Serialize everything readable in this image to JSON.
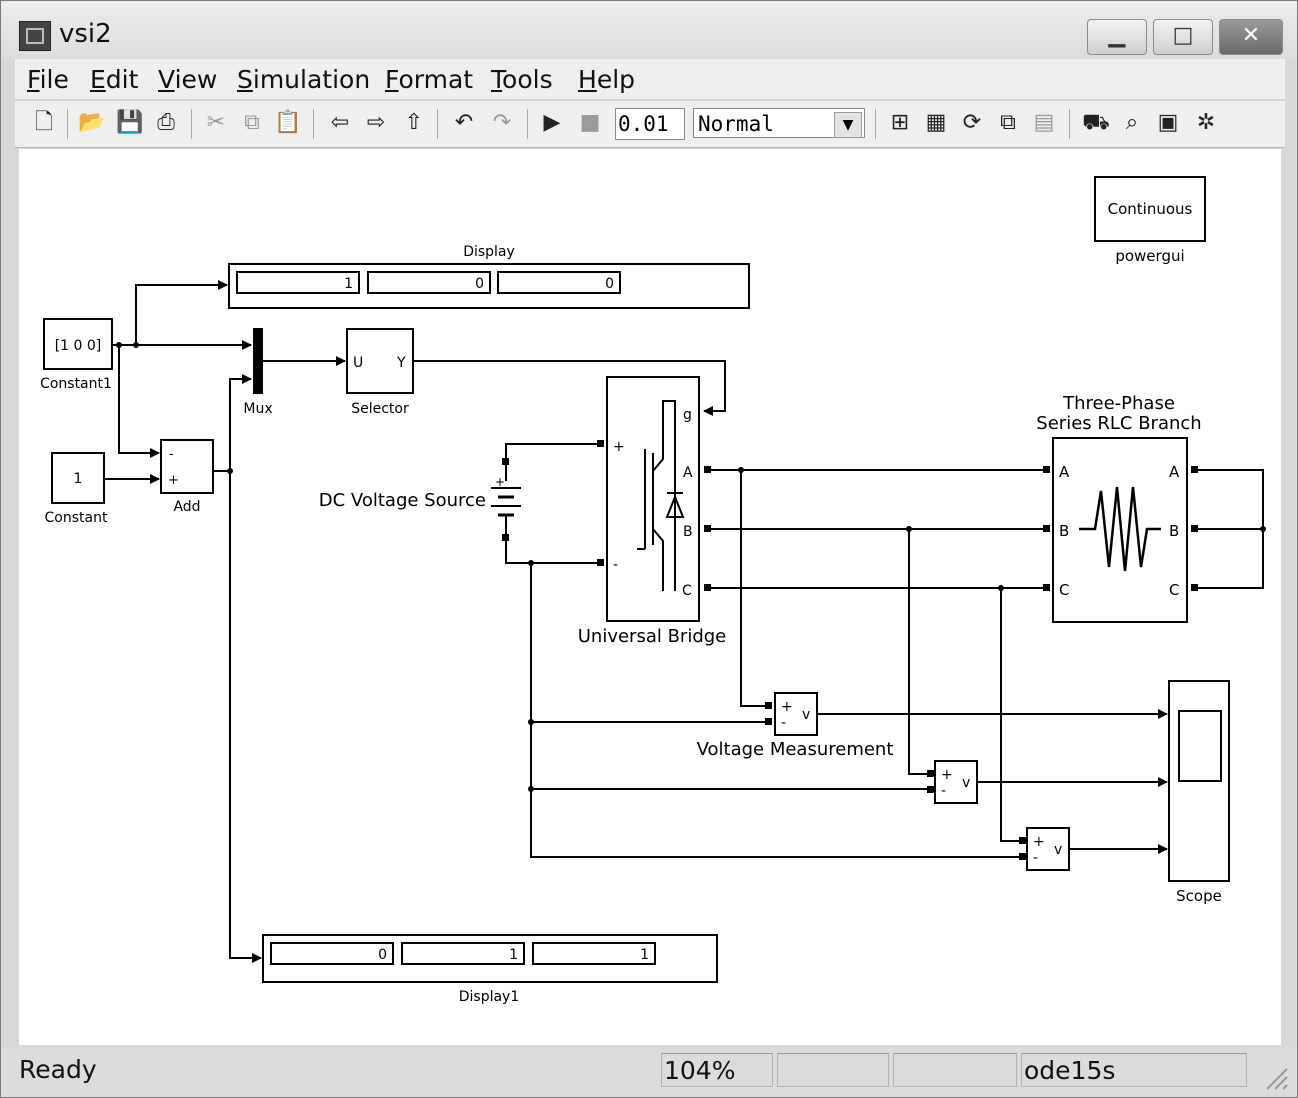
{
  "window": {
    "title": "vsi2",
    "minimize": "▁",
    "maximize": "□",
    "close": "✕"
  },
  "menu": [
    "File",
    "Edit",
    "View",
    "Simulation",
    "Format",
    "Tools",
    "Help"
  ],
  "toolbar": {
    "stop_time": "0.01",
    "sim_mode": "Normal",
    "icons": [
      "new-icon",
      "open-icon",
      "save-icon",
      "print-icon",
      "cut-icon",
      "copy-icon",
      "paste-icon",
      "back-icon",
      "forward-icon",
      "up-icon",
      "undo-icon",
      "redo-icon",
      "play-icon",
      "stop-icon",
      "library-icon",
      "debugger-icon",
      "refresh-icon",
      "build-icon",
      "model-icon",
      "explorer-icon",
      "advisor-icon",
      "browser-icon",
      "settings-icon"
    ]
  },
  "diagram": {
    "constant1": {
      "value": "[1 0 0]",
      "label": "Constant1"
    },
    "constant": {
      "value": "1",
      "label": "Constant"
    },
    "add": {
      "label": "Add",
      "in1": "-",
      "in2": "+"
    },
    "mux": {
      "label": "Mux"
    },
    "selector": {
      "label": "Selector",
      "in": "U",
      "out": "Y"
    },
    "display": {
      "label": "Display",
      "values": [
        "1",
        "0",
        "0"
      ]
    },
    "display1": {
      "label": "Display1",
      "values": [
        "0",
        "1",
        "1"
      ]
    },
    "powergui": {
      "value": "Continuous",
      "label": "powergui"
    },
    "dc_source": {
      "label": "DC Voltage Source"
    },
    "bridge": {
      "label": "Universal Bridge",
      "ports": [
        "g",
        "A",
        "B",
        "C",
        "+",
        "-"
      ]
    },
    "rlc": {
      "label_line1": "Three-Phase",
      "label_line2": "Series RLC Branch",
      "ports": [
        "A",
        "B",
        "C"
      ]
    },
    "voltage_meas": {
      "label": "Voltage Measurement",
      "plus": "+",
      "minus": "-",
      "out": "v"
    },
    "scope": {
      "label": "Scope"
    }
  },
  "status": {
    "state": "Ready",
    "zoom": "104%",
    "cell3": "",
    "cell4": "",
    "solver": "ode15s"
  }
}
